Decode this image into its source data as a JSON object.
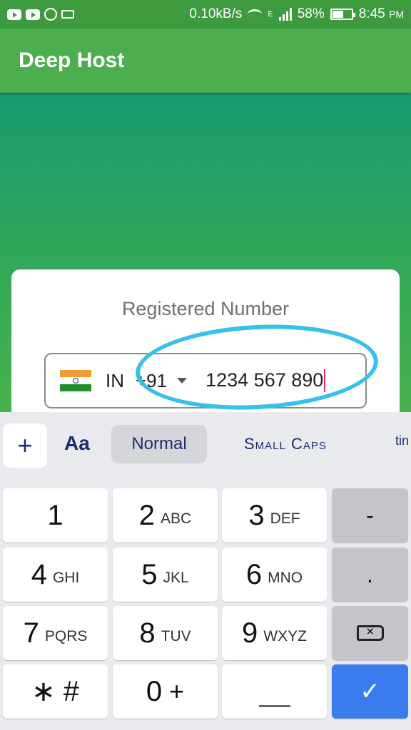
{
  "status_bar": {
    "network_speed": "0.10kB/s",
    "battery_percent": "58%",
    "time": "8:45",
    "ampm": "PM",
    "network_type": "E"
  },
  "app_bar": {
    "title": "Deep Host"
  },
  "login_card": {
    "label": "Registered Number",
    "country": "IN",
    "dial_code": "+91",
    "phone_value": "1234 567 890"
  },
  "keyboard_toolbar": {
    "plus": "+",
    "font_toggle": "Aa",
    "style_normal": "Normal",
    "style_small_caps": "Small Caps",
    "style_tiny": "tin"
  },
  "keyboard": {
    "k1": {
      "main": "1",
      "sub": ""
    },
    "k2": {
      "main": "2",
      "sub": "ABC"
    },
    "k3": {
      "main": "3",
      "sub": "DEF"
    },
    "k4": {
      "main": "4",
      "sub": "GHI"
    },
    "k5": {
      "main": "5",
      "sub": "JKL"
    },
    "k6": {
      "main": "6",
      "sub": "MNO"
    },
    "k7": {
      "main": "7",
      "sub": "PQRS"
    },
    "k8": {
      "main": "8",
      "sub": "TUV"
    },
    "k9": {
      "main": "9",
      "sub": "WXYZ"
    },
    "k0": {
      "main": "0",
      "sub": "+"
    },
    "star_hash": "∗ #",
    "dash": "-",
    "dot": "."
  },
  "colors": {
    "status_bar": "#3d9a3f",
    "app_bar": "#4cae4f",
    "accent_enter": "#3a7cee",
    "annotation": "#35c1e8"
  }
}
